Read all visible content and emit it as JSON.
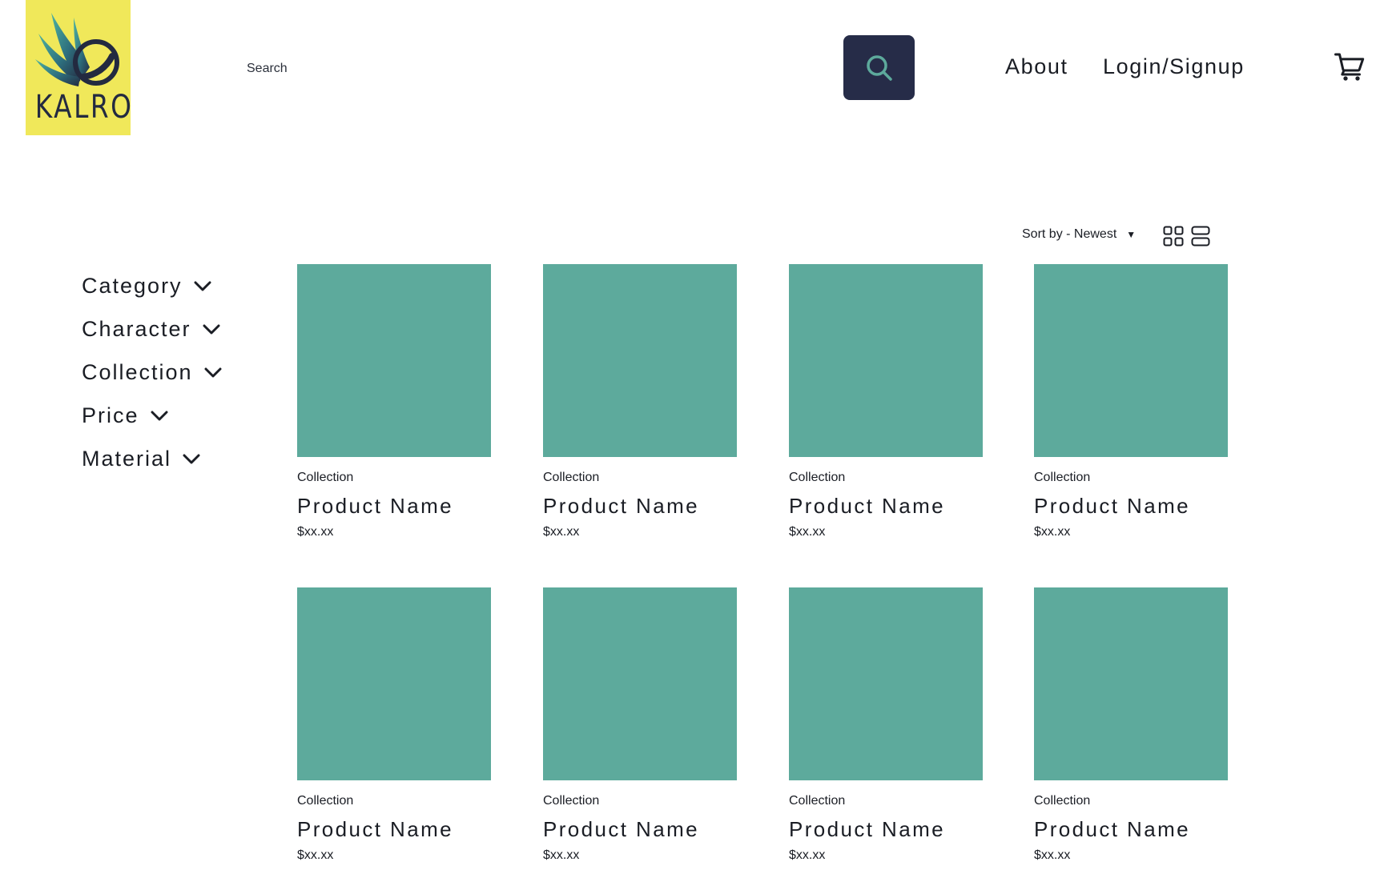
{
  "header": {
    "logo_text": "KALRO",
    "search_placeholder": "Search",
    "nav": {
      "about": "About",
      "login": "Login/Signup"
    }
  },
  "icons": {
    "search": "search-icon",
    "cart": "cart-icon",
    "grid_view": "grid-view-icon",
    "list_view": "list-view-icon",
    "chevron": "chevron-down-icon"
  },
  "colors": {
    "logo_bg": "#f0e85a",
    "search_button": "#262c48",
    "search_icon": "#5daa9c",
    "product_placeholder": "#5daa9c"
  },
  "toolbar": {
    "sort_label": "Sort by - Newest",
    "sort_caret": "▼"
  },
  "filters": [
    {
      "label": "Category"
    },
    {
      "label": "Character"
    },
    {
      "label": "Collection"
    },
    {
      "label": "Price"
    },
    {
      "label": "Material"
    }
  ],
  "products": [
    {
      "collection": "Collection",
      "name": "Product Name",
      "price": "$xx.xx"
    },
    {
      "collection": "Collection",
      "name": "Product Name",
      "price": "$xx.xx"
    },
    {
      "collection": "Collection",
      "name": "Product Name",
      "price": "$xx.xx"
    },
    {
      "collection": "Collection",
      "name": "Product Name",
      "price": "$xx.xx"
    },
    {
      "collection": "Collection",
      "name": "Product Name",
      "price": "$xx.xx"
    },
    {
      "collection": "Collection",
      "name": "Product Name",
      "price": "$xx.xx"
    },
    {
      "collection": "Collection",
      "name": "Product Name",
      "price": "$xx.xx"
    },
    {
      "collection": "Collection",
      "name": "Product Name",
      "price": "$xx.xx"
    }
  ]
}
